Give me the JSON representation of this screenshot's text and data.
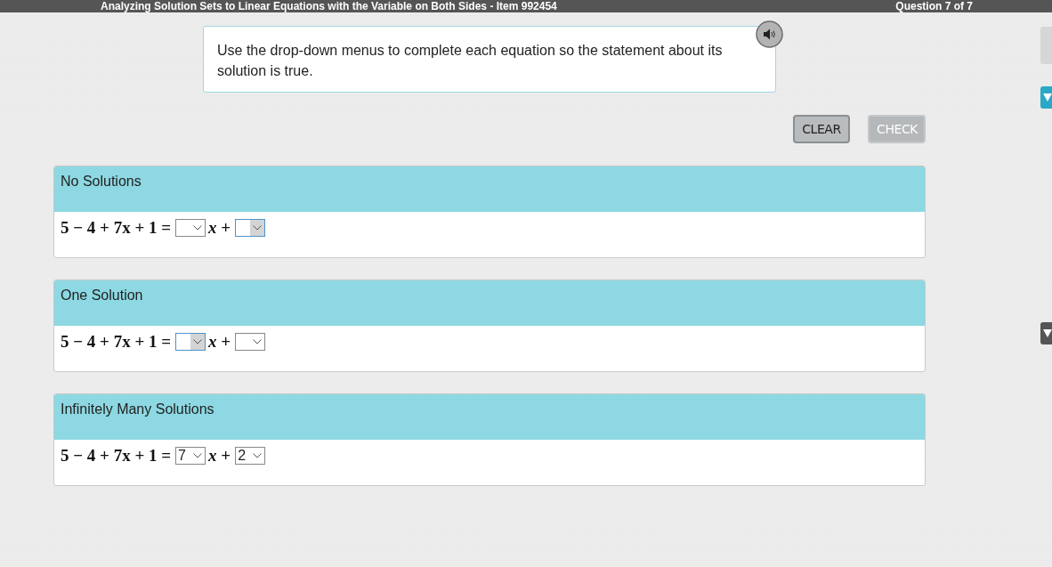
{
  "header": {
    "title": "Analyzing Solution Sets to Linear Equations with the Variable on Both Sides - Item 992454",
    "progress": "Question 7 of 7"
  },
  "instructions": "Use the drop-down menus to complete each equation so the statement about its solution is true.",
  "buttons": [
    {
      "label": "CLEAR",
      "disabled": false
    },
    {
      "label": "CHECK",
      "disabled": true
    }
  ],
  "parts": [
    {
      "title": "No Solutions",
      "equation": {
        "left": "5 − 4 + 7x + 1 =",
        "middle": "*x* +",
        "dropdowns": [
          {
            "highlighted": false
          },
          {
            "highlighted": true
          }
        ]
      }
    },
    {
      "title": "One Solution",
      "equation": {
        "left": "5 − 4 + 7x + 1 =",
        "middle": "*x* +",
        "dropdowns": [
          {
            "highlighted": true
          },
          {
            "highlighted": false
          }
        ]
      }
    },
    {
      "title": "Infinitely Many Solutions",
      "equation": {
        "left": "5 − 4 + 7x + 1 =",
        "middle": "*x* +",
        "dropdowns": [
          {
            "value": "7",
            "highlighted": false
          },
          {
            "value": "2",
            "highlighted": false
          }
        ]
      }
    }
  ]
}
